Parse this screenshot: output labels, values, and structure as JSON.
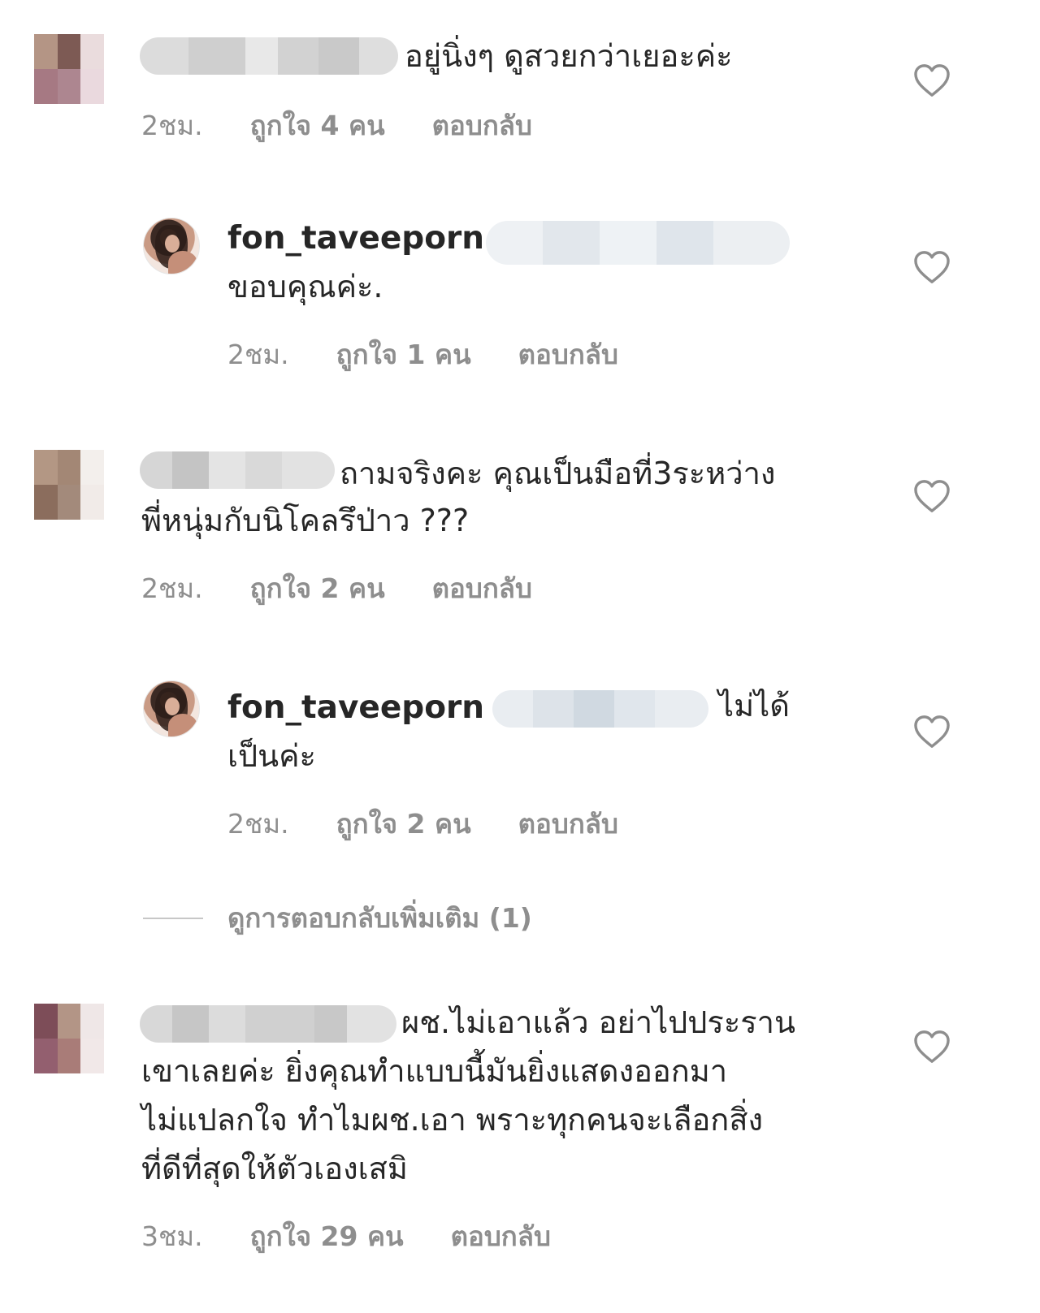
{
  "comments": [
    {
      "lines": [
        "อยู่นิ่งๆ ดูสวยกว่าเยอะค่ะ"
      ],
      "time": "2ชม.",
      "likes": "ถูกใจ 4 คน",
      "reply": "ตอบกลับ"
    },
    {
      "username": "fon_taveeporn",
      "lines": [
        "ขอบคุณค่ะ."
      ],
      "time": "2ชม.",
      "likes": "ถูกใจ 1 คน",
      "reply": "ตอบกลับ"
    },
    {
      "lines": [
        "ถามจริงคะ คุณเป็นมือที่3ระหว่าง",
        "พี่หนุ่มกับนิโคลรึป่าว ???"
      ],
      "time": "2ชม.",
      "likes": "ถูกใจ 2 คน",
      "reply": "ตอบกลับ"
    },
    {
      "username": "fon_taveeporn",
      "lines": [
        "ไม่ได้",
        "เป็นค่ะ"
      ],
      "time": "2ชม.",
      "likes": "ถูกใจ 2 คน",
      "reply": "ตอบกลับ"
    },
    {
      "lines": [
        "ผช.ไม่เอาแล้ว อย่าไปประราน",
        "เขาเลยค่ะ ยิ่งคุณทำแบบนี้มันยิ่งแสดงออกมา",
        "ไม่แปลกใจ ทำไมผช.เอา พราะทุกคนจะเลือกสิ่ง",
        "ที่ดีที่สุดให้ตัวเองเสมิ"
      ],
      "time": "3ชม.",
      "likes": "ถูกใจ 29 คน",
      "reply": "ตอบกลับ"
    }
  ],
  "view_more_replies": "ดูการตอบกลับเพิ่มเติม (1)",
  "icons": {
    "like": "heart-outline-icon"
  },
  "colors": {
    "text": "#262626",
    "secondary": "#8e8e8e"
  }
}
